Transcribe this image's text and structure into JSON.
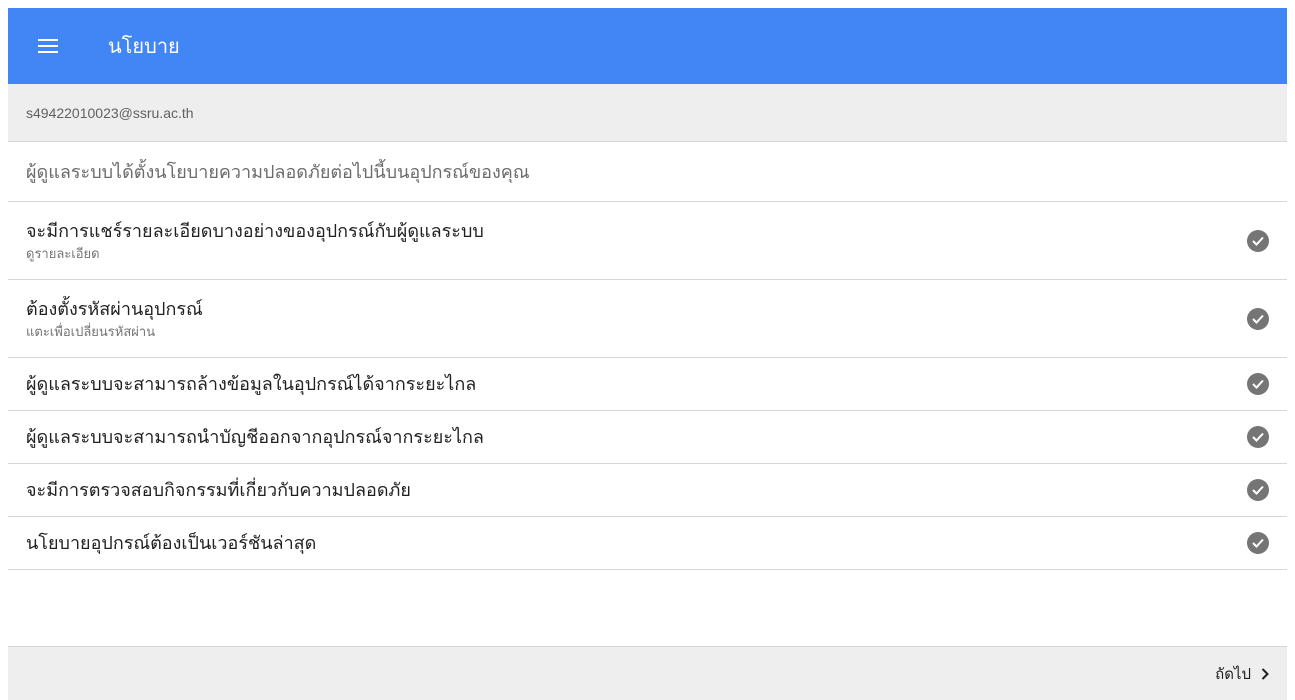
{
  "appbar": {
    "title": "นโยบาย",
    "menu_icon": "menu-icon",
    "color": "#4285f4"
  },
  "account": {
    "email": "s49422010023@ssru.ac.th"
  },
  "intro": {
    "text": "ผู้ดูแลระบบได้ตั้งนโยบายความปลอดภัยต่อไปนี้บนอุปกรณ์ของคุณ"
  },
  "policies": [
    {
      "title": "จะมีการแชร์รายละเอียดบางอย่างของอุปกรณ์กับผู้ดูแลระบบ",
      "subtitle": "ดูรายละเอียด",
      "icon": "check-circle-icon"
    },
    {
      "title": "ต้องตั้งรหัสผ่านอุปกรณ์",
      "subtitle": "แตะเพื่อเปลี่ยนรหัสผ่าน",
      "icon": "check-circle-icon"
    },
    {
      "title": "ผู้ดูแลระบบจะสามารถล้างข้อมูลในอุปกรณ์ได้จากระยะไกล",
      "icon": "check-circle-icon"
    },
    {
      "title": "ผู้ดูแลระบบจะสามารถนำบัญชีออกจากอุปกรณ์จากระยะไกล",
      "icon": "check-circle-icon"
    },
    {
      "title": "จะมีการตรวจสอบกิจกรรมที่เกี่ยวกับความปลอดภัย",
      "icon": "check-circle-icon"
    },
    {
      "title": "นโยบายอุปกรณ์ต้องเป็นเวอร์ชันล่าสุด",
      "icon": "check-circle-icon"
    }
  ],
  "footer": {
    "next_label": "ถัดไป",
    "next_icon": "chevron-right-icon"
  }
}
